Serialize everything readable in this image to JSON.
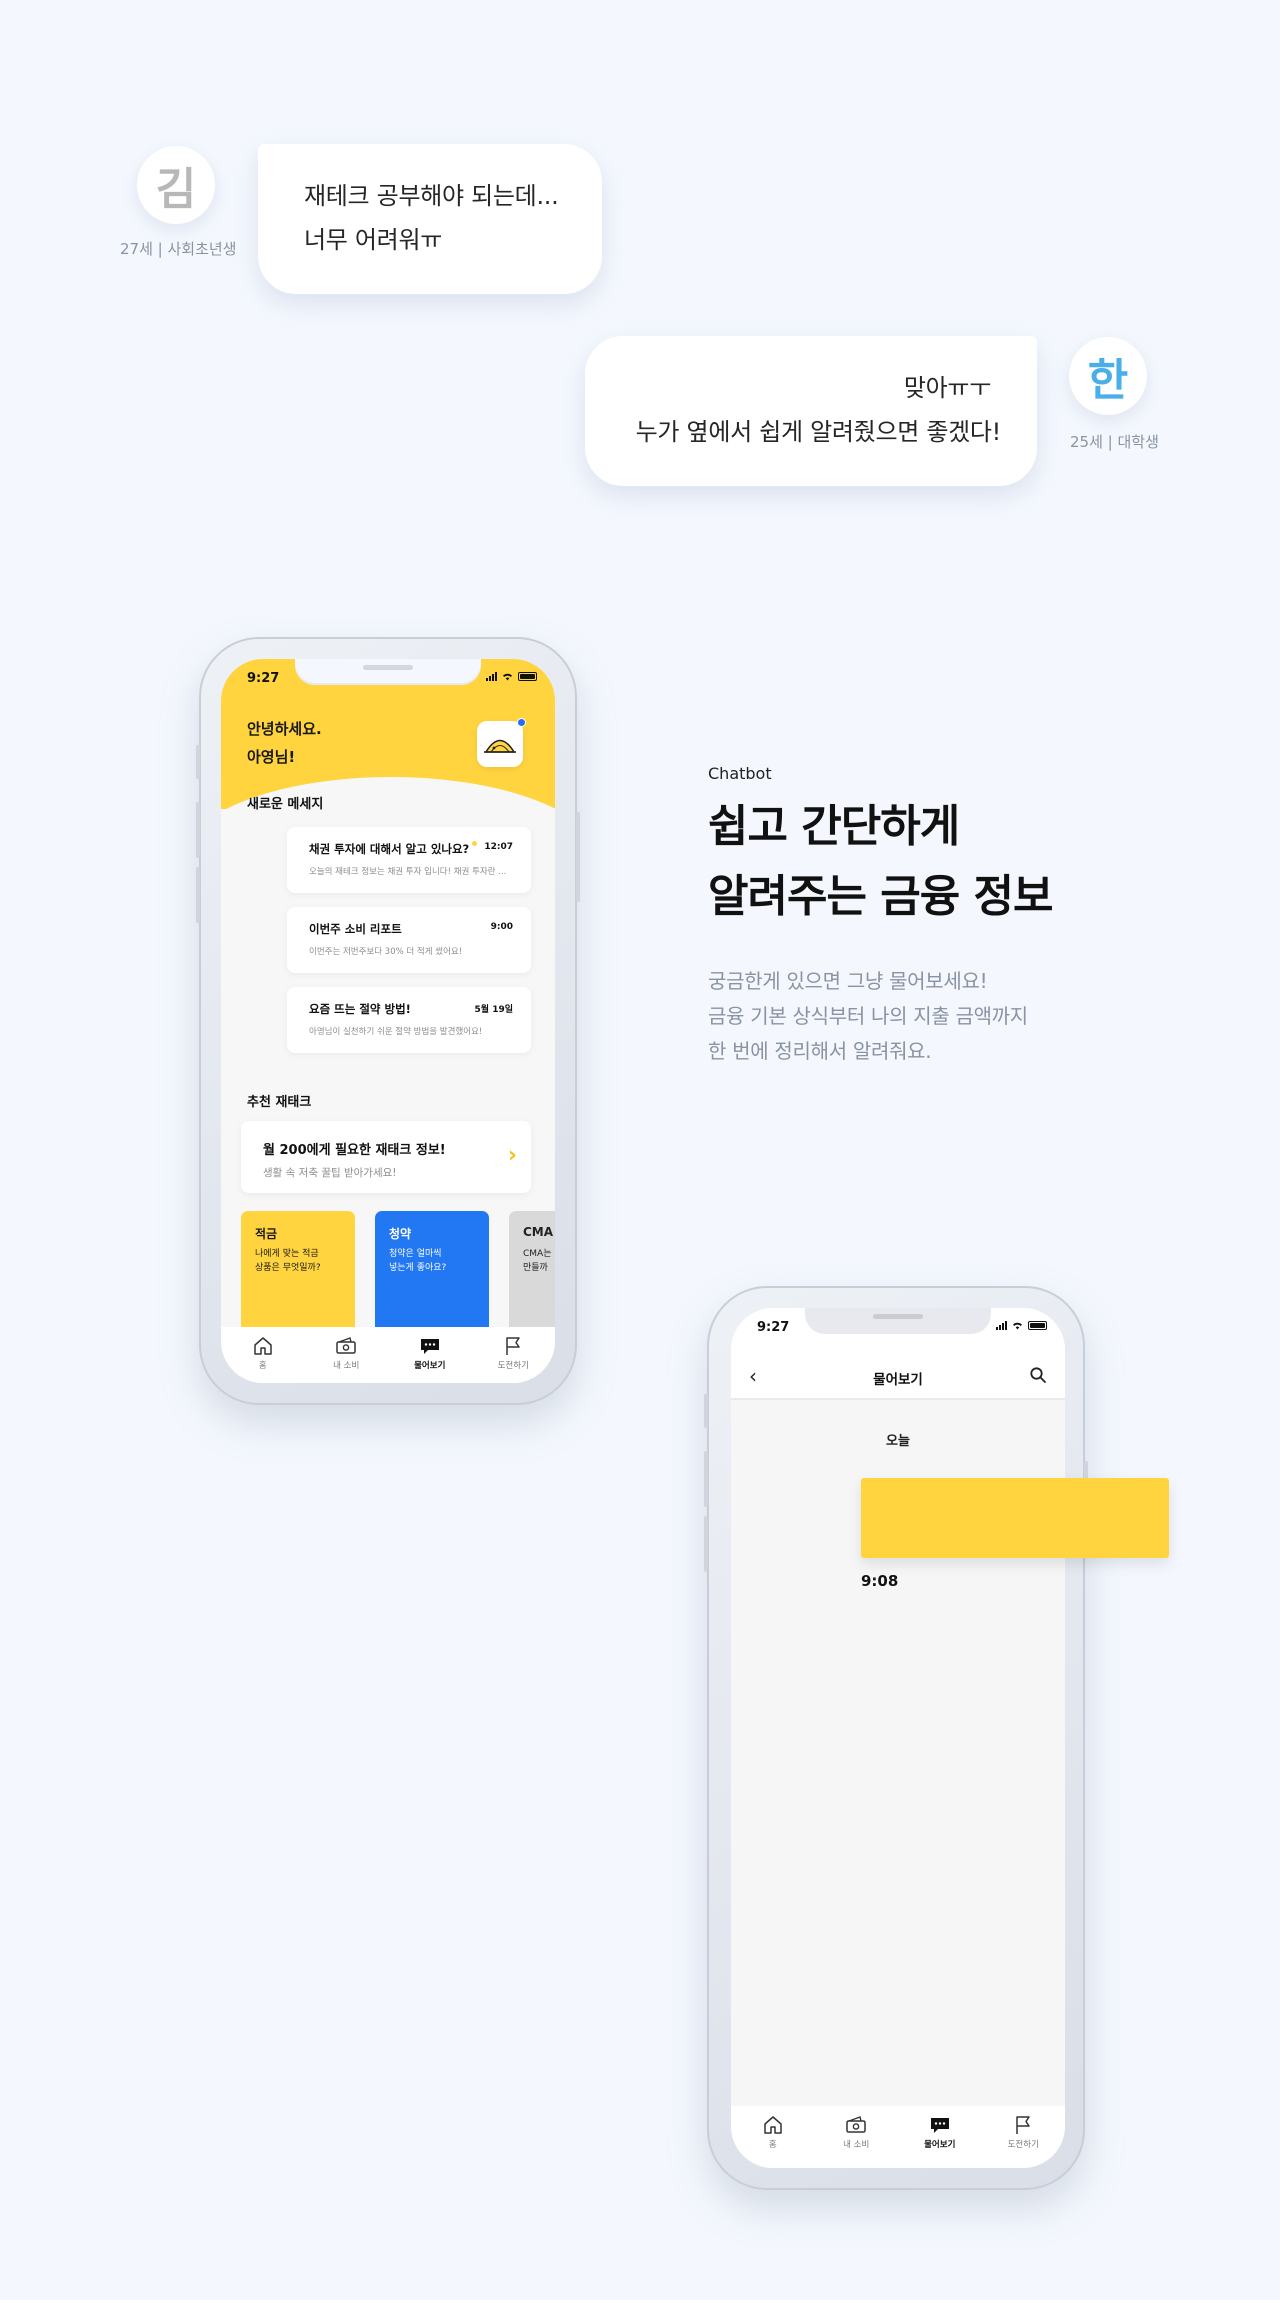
{
  "persona_kim": {
    "avatar_char": "김",
    "meta": "27세 | 사회초년생",
    "line1": "재테크 공부해야 되는데...",
    "line2": "너무 어려워ㅠ"
  },
  "persona_han": {
    "avatar_char": "한",
    "meta": "25세 | 대학생",
    "line1": "맞아ㅠㅜ",
    "line2": "누가 옆에서 쉽게 알려줬으면 좋겠다!"
  },
  "home_screen": {
    "status_time": "9:27",
    "greeting_line1": "안녕하세요.",
    "greeting_line2": "아영님!",
    "new_messages_title": "새로운 메세지",
    "messages": [
      {
        "title": "채권 투자에 대해서 알고 있나요?",
        "time": "12:07",
        "preview": "오늘의 재테크 정보는 채권 투자 입니다! 채권 투자란 ..."
      },
      {
        "title": "이번주 소비 리포트",
        "time": "9:00",
        "preview": "이번주는 저번주보다 30% 더 적게 썼어요!"
      },
      {
        "title": "요즘 뜨는 절약 방법!",
        "time": "5월 19일",
        "preview": "아영님이 실천하기 쉬운 절약 방법을 발견했어요!"
      }
    ],
    "recommend_title": "추천 재태크",
    "recommend_card": {
      "title": "월 200에게 필요한 재태크 정보!",
      "subtitle": "생활 속 저축 꿀팁 받아가세요!"
    },
    "tiles": [
      {
        "title": "적금",
        "line1": "나에게 맞는 적금",
        "line2": "상품은 무엇일까?",
        "bg": "#ffd43f",
        "fg": "#1a1a1a"
      },
      {
        "title": "청약",
        "line1": "청약은 얼마씩",
        "line2": "넣는게 좋아요?",
        "bg": "#2277f2",
        "fg": "#ffffff"
      },
      {
        "title": "CMA",
        "line1": "CMA는",
        "line2": "만들까",
        "bg": "#d9d9d9",
        "fg": "#222222"
      }
    ]
  },
  "tabs": [
    {
      "label": "홈",
      "icon": "home-icon"
    },
    {
      "label": "내 소비",
      "icon": "wallet-icon"
    },
    {
      "label": "물어보기",
      "icon": "chat-icon"
    },
    {
      "label": "도전하기",
      "icon": "flag-icon"
    }
  ],
  "active_tab": 2,
  "feature": {
    "eyebrow": "Chatbot",
    "headline_line1": "쉽고 간단하게",
    "headline_line2": "알려주는 금융 정보",
    "desc_line1": "궁금한게 있으면 그냥 물어보세요!",
    "desc_line2": "금융 기본 상식부터 나의 지출 금액까지",
    "desc_line3": "한 번에 정리해서 알려줘요."
  },
  "chat_screen": {
    "status_time": "9:27",
    "title": "물어보기",
    "date_label": "오늘",
    "message_time": "9:08"
  },
  "colors": {
    "accent_yellow": "#ffd43f",
    "accent_blue": "#2277f2",
    "han_avatar": "#4aaee8",
    "kim_avatar": "#b8b8b8"
  }
}
